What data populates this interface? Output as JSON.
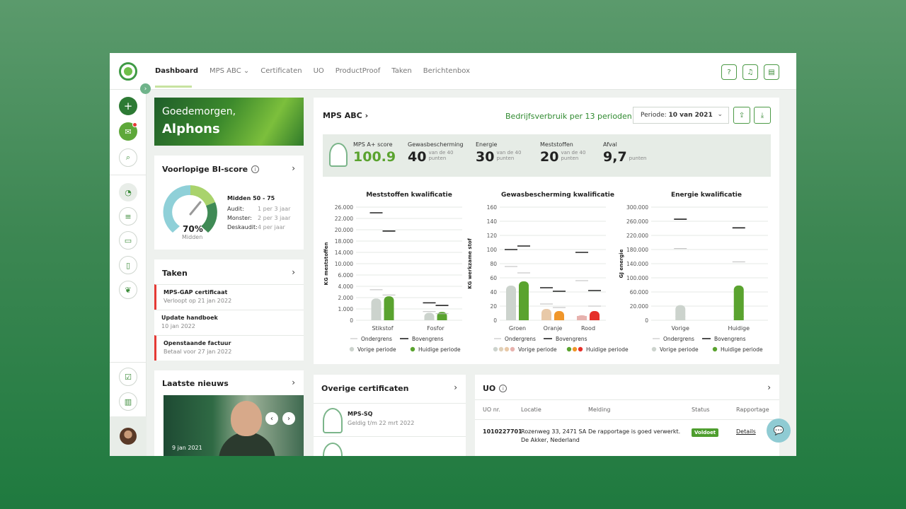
{
  "nav": {
    "items": [
      "Dashboard",
      "MPS ABC",
      "Certificaten",
      "UO",
      "ProductProof",
      "Taken",
      "Berichtenbox"
    ],
    "active": "Dashboard"
  },
  "topbar_icons": [
    "help-icon",
    "bell-icon",
    "table-icon"
  ],
  "sidebar": {
    "icons": [
      "plus-icon",
      "mail-icon",
      "search-icon",
      "gauge-icon",
      "list-icon",
      "card-icon",
      "clipboard-icon",
      "leaf-icon",
      "checklist-icon",
      "building-icon"
    ]
  },
  "greeting": {
    "hello": "Goedemorgen,",
    "name": "Alphons"
  },
  "bi_score": {
    "title": "Voorlopige BI-score",
    "percent": "70%",
    "level": "Midden",
    "range": "Midden 50 - 75",
    "rows": [
      {
        "label": "Audit:",
        "value": "1 per 3 jaar"
      },
      {
        "label": "Monster:",
        "value": "2 per 3 jaar"
      },
      {
        "label": "Deskaudit:",
        "value": "4 per jaar"
      }
    ]
  },
  "taken": {
    "title": "Taken",
    "items": [
      {
        "title": "MPS-GAP certificaat",
        "sub": "Verloopt op 21 jan 2022",
        "urgent": true
      },
      {
        "title": "Update handboek",
        "sub": "10 jan 2022",
        "urgent": false
      },
      {
        "title": "Openstaande factuur",
        "sub": "Betaal voor 27 jan 2022",
        "urgent": true
      }
    ]
  },
  "news": {
    "title": "Laatste nieuws",
    "date": "9 jan 2021"
  },
  "main": {
    "title": "MPS  ABC",
    "usage": "Bedrijfsverbruik per 13 perioden",
    "period_label": "Periode:",
    "period_value": "10 van 2021",
    "scores": [
      {
        "label": "MPS A+ score",
        "value": "100.9",
        "sub": ""
      },
      {
        "label": "Gewasbescherming",
        "value": "40",
        "sub": "van de 40 punten"
      },
      {
        "label": "Energie",
        "value": "30",
        "sub": "van de 40 punten"
      },
      {
        "label": "Meststoffen",
        "value": "20",
        "sub": "van de 40 punten"
      },
      {
        "label": "Afval",
        "value": "9,7",
        "sub": "punten"
      }
    ]
  },
  "colors": {
    "vorige": "#ccd3cd",
    "huidige": "#5aa32f",
    "oranje_vorige": "#e8c9a8",
    "oranje_huidige": "#f0962a",
    "rood_vorige": "#e7b2ae",
    "rood_huidige": "#e5302a"
  },
  "chart_data": [
    {
      "type": "bar",
      "title": "Meststoffen kwalificatie",
      "ylabel": "KG meststoffen",
      "ylim": [
        0,
        26000
      ],
      "yticks": [
        "26.000",
        "22.000",
        "20.000",
        "18.000",
        "14.000",
        "10.000",
        "6.000",
        "4.000",
        "2.000",
        "1.000",
        "0"
      ],
      "categories": [
        "Stikstof",
        "Fosfor"
      ],
      "series": [
        {
          "name": "Vorige periode",
          "values": [
            5000,
            1700
          ]
        },
        {
          "name": "Huidige periode",
          "values": [
            5500,
            1900
          ]
        }
      ],
      "ondergrens": [
        {
          "vorige": 7000,
          "huidige": 5800
        },
        {
          "vorige": 2000,
          "huidige": 1500
        }
      ],
      "bovengrens": [
        {
          "vorige": 24700,
          "huidige": 20500
        },
        {
          "vorige": 4000,
          "huidige": 3400
        }
      ],
      "legend": [
        "Ondergrens",
        "Bovengrens",
        "Vorige periode",
        "Huidige periode"
      ]
    },
    {
      "type": "bar",
      "title": "Gewasbescherming kwalificatie",
      "ylabel": "KG werkzame stof",
      "ylim": [
        0,
        160
      ],
      "yticks": [
        "160",
        "140",
        "120",
        "100",
        "80",
        "60",
        "40",
        "20",
        "0"
      ],
      "categories": [
        "Groen",
        "Oranje",
        "Rood"
      ],
      "series": [
        {
          "name": "Vorige periode",
          "values": [
            49,
            16,
            7
          ]
        },
        {
          "name": "Huidige periode",
          "values": [
            55,
            13,
            13
          ]
        }
      ],
      "ondergrens": [
        {
          "vorige": 76,
          "huidige": 67
        },
        {
          "vorige": 23,
          "huidige": 18
        },
        {
          "vorige": 56,
          "huidige": 20
        }
      ],
      "bovengrens": [
        {
          "vorige": 100,
          "huidige": 105
        },
        {
          "vorige": 46,
          "huidige": 41
        },
        {
          "vorige": 96,
          "huidige": 42
        }
      ],
      "legend": [
        "Ondergrens",
        "Bovengrens",
        "Vorige periode",
        "Huidige periode"
      ]
    },
    {
      "type": "bar",
      "title": "Energie kwalificatie",
      "ylabel": "GJ energie",
      "ylim": [
        0,
        300000
      ],
      "yticks": [
        "300.000",
        "260.000",
        "220.000",
        "180.000",
        "140.000",
        "100.000",
        "60.000",
        "20.000",
        "0"
      ],
      "categories": [
        "Vorige",
        "Huidige"
      ],
      "series": [
        {
          "name": "Vorige periode",
          "values": [
            40000,
            null
          ]
        },
        {
          "name": "Huidige periode",
          "values": [
            null,
            92000
          ]
        }
      ],
      "ondergrens": [
        {
          "value": 190000
        },
        {
          "value": 155000
        }
      ],
      "bovengrens": [
        {
          "value": 268000
        },
        {
          "value": 245000
        }
      ],
      "legend": [
        "Ondergrens",
        "Bovengrens",
        "Vorige periode",
        "Huidige periode"
      ]
    }
  ],
  "certificates": {
    "title": "Overige certificaten",
    "items": [
      {
        "name": "MPS-SQ",
        "valid": "Geldig t/m 22 mrt 2022"
      }
    ]
  },
  "uo": {
    "title": "UO",
    "columns": [
      "UO nr.",
      "Locatie",
      "Melding",
      "Status",
      "Rapportage"
    ],
    "rows": [
      {
        "nr": "1010227701",
        "locatie1": "Rozenweg 33, 2471 SA",
        "locatie2": "De Akker, Nederland",
        "melding": "De rapportage is goed verwerkt.",
        "status": "Voldoet",
        "rapportage": "Details"
      }
    ]
  }
}
